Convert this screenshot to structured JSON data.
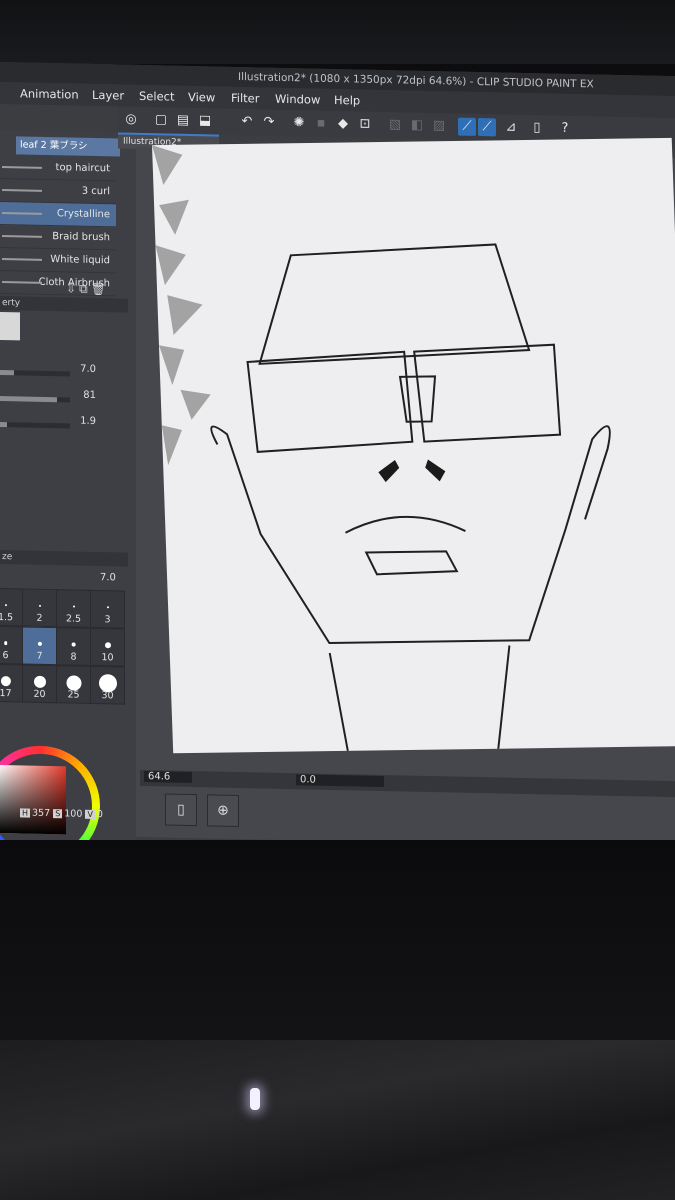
{
  "window": {
    "title": "Illustration2* (1080 x 1350px 72dpi 64.6%) - CLIP STUDIO PAINT EX"
  },
  "menu": [
    "Animation",
    "Layer",
    "Select",
    "View",
    "Filter",
    "Window",
    "Help"
  ],
  "document_tab": {
    "label": "Illustration2*"
  },
  "toolbar_icons": [
    "clip-studio-icon",
    "new-icon",
    "open-icon",
    "save-icon",
    "undo-icon",
    "redo-icon",
    "loading-icon",
    "fill-icon",
    "transform-icon",
    "crop-icon",
    "pen-icon",
    "pen-active-icon",
    "ruler-icon",
    "notes-icon",
    "help-icon"
  ],
  "brush_panel": {
    "header": "leaf 2 葉ブラシ",
    "items": [
      {
        "label": "top haircut"
      },
      {
        "label": "3 curl"
      },
      {
        "label": "Crystalline",
        "selected": true
      },
      {
        "label": "Braid brush"
      },
      {
        "label": "White liquid"
      },
      {
        "label": "Cloth Airbrush"
      }
    ]
  },
  "tool_property": {
    "header": "erty",
    "sliders": [
      {
        "value": "7.0",
        "fill": 0.2
      },
      {
        "value": "81",
        "fill": 0.81
      },
      {
        "value": "1.9",
        "fill": 0.1
      }
    ]
  },
  "brush_size": {
    "header": "ze",
    "current": "7.0",
    "sizes": [
      {
        "label": "1.5"
      },
      {
        "label": "2"
      },
      {
        "label": "2.5"
      },
      {
        "label": "3"
      },
      {
        "label": "6"
      },
      {
        "label": "7",
        "selected": true
      },
      {
        "label": "8"
      },
      {
        "label": "10"
      },
      {
        "label": "17"
      },
      {
        "label": "20"
      },
      {
        "label": "25"
      },
      {
        "label": "30"
      }
    ]
  },
  "color": {
    "h_label": "H",
    "h": "357",
    "s_label": "S",
    "s": "100",
    "v_label": "V",
    "v": "0",
    "hue_hex": "#e23a2a"
  },
  "status": {
    "zoom": "64.6",
    "angle": "0.0"
  }
}
